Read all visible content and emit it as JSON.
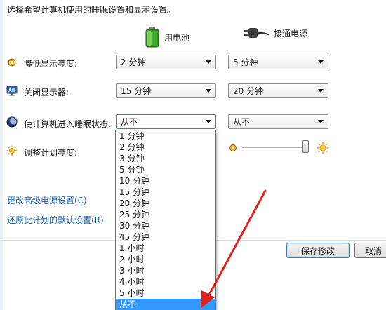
{
  "intro": "选择希望计算机使用的睡眠设置和显示设置。",
  "columns": {
    "battery": "用电池",
    "plugged_in": "接通电源"
  },
  "rows": {
    "dim_display": {
      "label": "降低显示亮度:",
      "battery": "2 分钟",
      "plugged_in": "5 分钟"
    },
    "turn_off_display": {
      "label": "关闭显示器:",
      "battery": "15 分钟",
      "plugged_in": "20 分钟"
    },
    "sleep": {
      "label": "使计算机进入睡眠状态:",
      "battery": "从不",
      "plugged_in": "从不"
    },
    "brightness": {
      "label": "调整计划亮度:"
    }
  },
  "dropdown_options": [
    "1 分钟",
    "2 分钟",
    "3 分钟",
    "5 分钟",
    "10 分钟",
    "15 分钟",
    "20 分钟",
    "25 分钟",
    "30 分钟",
    "45 分钟",
    "1 小时",
    "2 小时",
    "3 小时",
    "4 小时",
    "5 小时",
    "从不"
  ],
  "dropdown_selected": "从不",
  "links": {
    "advanced": "更改高级电源设置(C)",
    "restore": "还原此计划的默认设置(R)"
  },
  "buttons": {
    "save": "保存修改",
    "cancel": "取消"
  },
  "icons": {
    "battery": "battery-icon",
    "plug": "power-plug-icon",
    "dim": "dim-display-icon",
    "monitor": "monitor-icon",
    "sleep": "sleep-moon-icon",
    "brightness": "sun-icon",
    "brightness_low": "sun-small-icon",
    "brightness_high": "sun-large-icon"
  },
  "colors": {
    "link": "#1a5ea8",
    "selection": "#3399ff",
    "arrow": "#e0201b",
    "battery_green": "#3fae2a"
  }
}
